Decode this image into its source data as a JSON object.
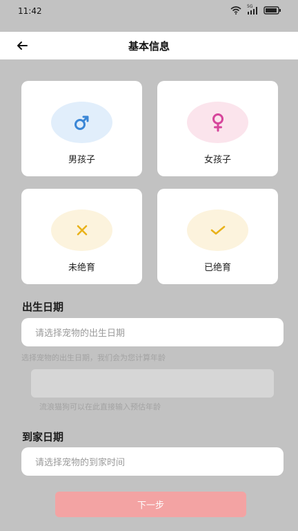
{
  "status": {
    "time": "11:42",
    "net_label": "5G"
  },
  "nav": {
    "title": "基本信息"
  },
  "cards": {
    "male": {
      "label": "男孩子",
      "color": "#3a86d6",
      "bg": "#e1eefb"
    },
    "female": {
      "label": "女孩子",
      "color": "#d6459b",
      "bg": "#fbe4ec"
    },
    "not_neutered": {
      "label": "未绝育",
      "color": "#e9b21a",
      "bg": "#fcf3dd"
    },
    "neutered": {
      "label": "已绝育",
      "color": "#e9b21a",
      "bg": "#fcf3dd"
    }
  },
  "birth": {
    "title": "出生日期",
    "placeholder": "请选择宠物的出生日期",
    "hint": "选择宠物的出生日期，我们会为您计算年龄",
    "age_hint": "流浪猫狗可以在此直接输入预估年龄"
  },
  "home": {
    "title": "到家日期",
    "placeholder": "请选择宠物的到家时间"
  },
  "next_button": {
    "label": "下一步"
  }
}
